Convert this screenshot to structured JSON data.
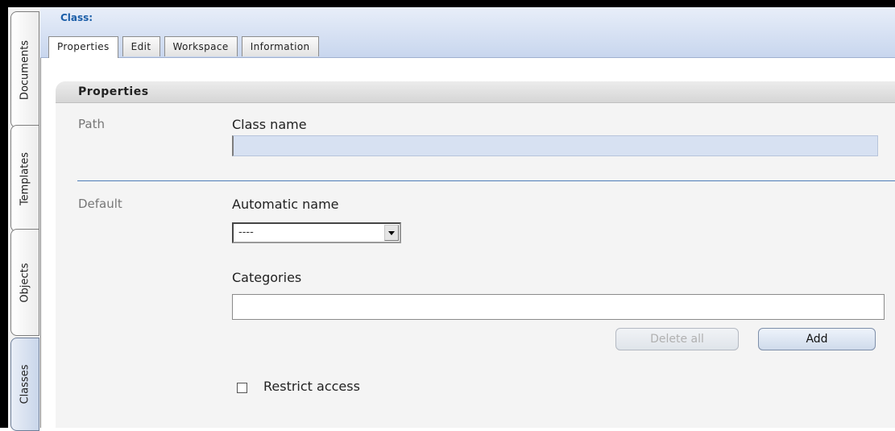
{
  "sidebar": {
    "tabs": [
      {
        "label": "Documents",
        "active": false
      },
      {
        "label": "Templates",
        "active": false
      },
      {
        "label": "Objects",
        "active": false
      },
      {
        "label": "Classes",
        "active": true
      }
    ]
  },
  "header": {
    "title": "Class:",
    "tabs": [
      {
        "label": "Properties",
        "active": true
      },
      {
        "label": "Edit",
        "active": false
      },
      {
        "label": "Workspace",
        "active": false
      },
      {
        "label": "Information",
        "active": false
      }
    ]
  },
  "panel": {
    "title": "Properties",
    "path_section": {
      "label": "Path",
      "class_name_label": "Class name",
      "class_name_value": ""
    },
    "default_section": {
      "label": "Default",
      "automatic_name_label": "Automatic name",
      "automatic_name_value": "----",
      "categories_label": "Categories",
      "categories_value": "",
      "delete_all_label": "Delete all",
      "add_label": "Add",
      "restrict_access_label": "Restrict access",
      "restrict_access_checked": false
    }
  },
  "colors": {
    "accent": "#1b5ea8",
    "header_bg": "#c8d6ee",
    "input_bg": "#d7e1f2"
  }
}
